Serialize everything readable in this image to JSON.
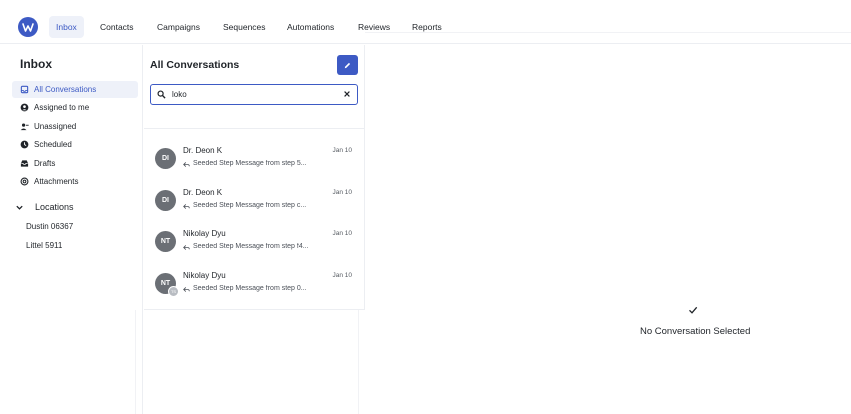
{
  "nav": {
    "logo_icon": "brand-logo-icon",
    "tabs": [
      {
        "label": "Inbox",
        "active": true
      },
      {
        "label": "Contacts",
        "active": false
      },
      {
        "label": "Campaigns",
        "active": false
      },
      {
        "label": "Sequences",
        "active": false
      },
      {
        "label": "Automations",
        "active": false
      },
      {
        "label": "Reviews",
        "active": false
      },
      {
        "label": "Reports",
        "active": false
      }
    ]
  },
  "sidebar": {
    "title": "Inbox",
    "items": [
      {
        "label": "All Conversations",
        "icon": "inbox-icon",
        "active": true
      },
      {
        "label": "Assigned to me",
        "icon": "user-circle-icon",
        "active": false
      },
      {
        "label": "Unassigned",
        "icon": "user-minus-icon",
        "active": false
      },
      {
        "label": "Scheduled",
        "icon": "clock-icon",
        "active": false
      },
      {
        "label": "Drafts",
        "icon": "drafts-tray-icon",
        "active": false
      },
      {
        "label": "Attachments",
        "icon": "attachment-icon",
        "active": false
      }
    ],
    "locations": {
      "label": "Locations",
      "items": [
        "Dustin 06367",
        "Littel 5911"
      ]
    }
  },
  "conversations": {
    "title": "All Conversations",
    "compose_icon": "pencil-icon",
    "search": {
      "value": "loko",
      "placeholder": ""
    },
    "items": [
      {
        "initials": "DI",
        "name": "Dr. Deon K",
        "date": "Jan 10",
        "preview": "Seeded Step Message from step 5...",
        "badge": ""
      },
      {
        "initials": "DI",
        "name": "Dr. Deon K",
        "date": "Jan 10",
        "preview": "Seeded Step Message from step c...",
        "badge": ""
      },
      {
        "initials": "NT",
        "name": "Nikolay Dyu",
        "date": "Jan 10",
        "preview": "Seeded Step Message from step f4...",
        "badge": ""
      },
      {
        "initials": "NT",
        "name": "Nikolay Dyu",
        "date": "Jan 10",
        "preview": "Seeded Step Message from step 0...",
        "badge": "TS"
      }
    ]
  },
  "detail": {
    "empty_text": "No Conversation Selected",
    "empty_icon": "check-icon"
  },
  "colors": {
    "accent": "#3d5ac4",
    "active_bg": "#eef1f9",
    "avatar_bg": "#6b6f75"
  }
}
